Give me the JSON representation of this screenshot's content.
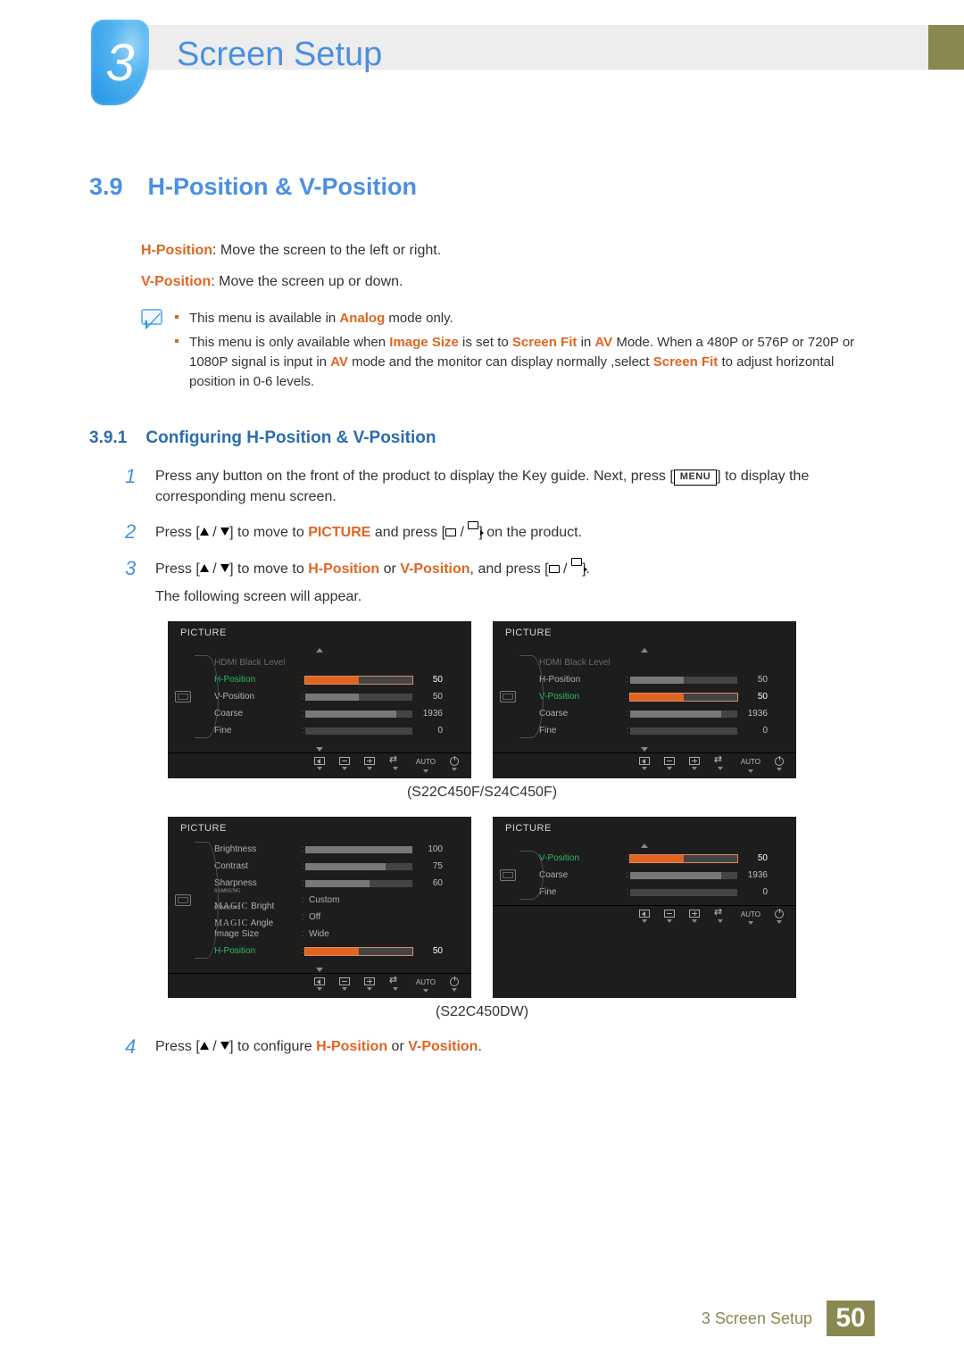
{
  "chapter": {
    "number": "3",
    "title": "Screen Setup"
  },
  "section": {
    "number": "3.9",
    "title": "H-Position & V-Position",
    "hpos_label": "H-Position",
    "hpos_desc": ": Move the screen to the left or right.",
    "vpos_label": "V-Position",
    "vpos_desc": ": Move the screen up or down."
  },
  "notes": {
    "item1_pre": "This menu is available in ",
    "item1_hl": "Analog",
    "item1_post": " mode only.",
    "item2_a": "This menu is only available when ",
    "item2_hl1": "Image Size",
    "item2_b": " is set to ",
    "item2_hl2": "Screen Fit",
    "item2_c": " in ",
    "item2_hl3": "AV",
    "item2_d": " Mode. When a 480P or 576P or 720P or 1080P signal is input in ",
    "item2_hl4": "AV",
    "item2_e": " mode and the monitor can display normally ,select ",
    "item2_hl5": "Screen Fit",
    "item2_f": " to adjust horizontal position in 0-6 levels."
  },
  "subsection": {
    "number": "3.9.1",
    "title": "Configuring H-Position & V-Position"
  },
  "steps": {
    "1": {
      "n": "1",
      "a": "Press any button on the front of the product to display the Key guide. Next, press [",
      "menu": "MENU",
      "b": "] to display the corresponding menu screen."
    },
    "2": {
      "n": "2",
      "a": "Press [",
      "b": "] to move to ",
      "picture": "PICTURE",
      "c": " and press [",
      "d": "] on the product."
    },
    "3": {
      "n": "3",
      "a": "Press [",
      "b": "] to move to ",
      "h": "H-Position",
      "or": " or ",
      "v": "V-Position",
      "c": ", and press [",
      "d": "].",
      "follow": "The following screen will appear."
    },
    "4": {
      "n": "4",
      "a": "Press [",
      "b": "] to configure ",
      "h": "H-Position",
      "or": " or ",
      "v": "V-Position",
      "c": "."
    }
  },
  "osd": {
    "title": "PICTURE",
    "auto": "AUTO",
    "panel1": {
      "items": [
        {
          "label": "HDMI Black Level",
          "dim": true
        },
        {
          "label": "H-Position",
          "sel": true,
          "bar": 50,
          "max": 100,
          "val": "50"
        },
        {
          "label": "V-Position",
          "bar": 50,
          "max": 100,
          "val": "50"
        },
        {
          "label": "Coarse",
          "bar": 85,
          "max": 100,
          "val": "1936"
        },
        {
          "label": "Fine",
          "bar": 0,
          "max": 100,
          "val": "0"
        }
      ]
    },
    "panel2": {
      "items": [
        {
          "label": "HDMI Black Level",
          "dim": true
        },
        {
          "label": "H-Position",
          "bar": 50,
          "max": 100,
          "val": "50"
        },
        {
          "label": "V-Position",
          "sel": true,
          "bar": 50,
          "max": 100,
          "val": "50"
        },
        {
          "label": "Coarse",
          "bar": 85,
          "max": 100,
          "val": "1936"
        },
        {
          "label": "Fine",
          "bar": 0,
          "max": 100,
          "val": "0"
        }
      ]
    },
    "caption1": "(S22C450F/S24C450F)",
    "panel3": {
      "items": [
        {
          "label": "Brightness",
          "bar": 100,
          "max": 100,
          "val": "100"
        },
        {
          "label": "Contrast",
          "bar": 75,
          "max": 100,
          "val": "75"
        },
        {
          "label": "Sharpness",
          "bar": 60,
          "max": 100,
          "val": "60"
        },
        {
          "label": "SAMSUNG MAGIC Bright",
          "text": "Custom",
          "magic": true
        },
        {
          "label": "SAMSUNG MAGIC Angle",
          "text": "Off",
          "magic": true
        },
        {
          "label": "Image Size",
          "text": "Wide"
        },
        {
          "label": "H-Position",
          "sel": true,
          "bar": 50,
          "max": 100,
          "val": "50"
        }
      ]
    },
    "panel4": {
      "items": [
        {
          "label": "V-Position",
          "sel": true,
          "bar": 50,
          "max": 100,
          "val": "50"
        },
        {
          "label": "Coarse",
          "bar": 85,
          "max": 100,
          "val": "1936"
        },
        {
          "label": "Fine",
          "bar": 0,
          "max": 100,
          "val": "0"
        }
      ]
    },
    "caption2": "(S22C450DW)"
  },
  "footer": {
    "crumb": "3  Screen Setup",
    "page": "50"
  }
}
